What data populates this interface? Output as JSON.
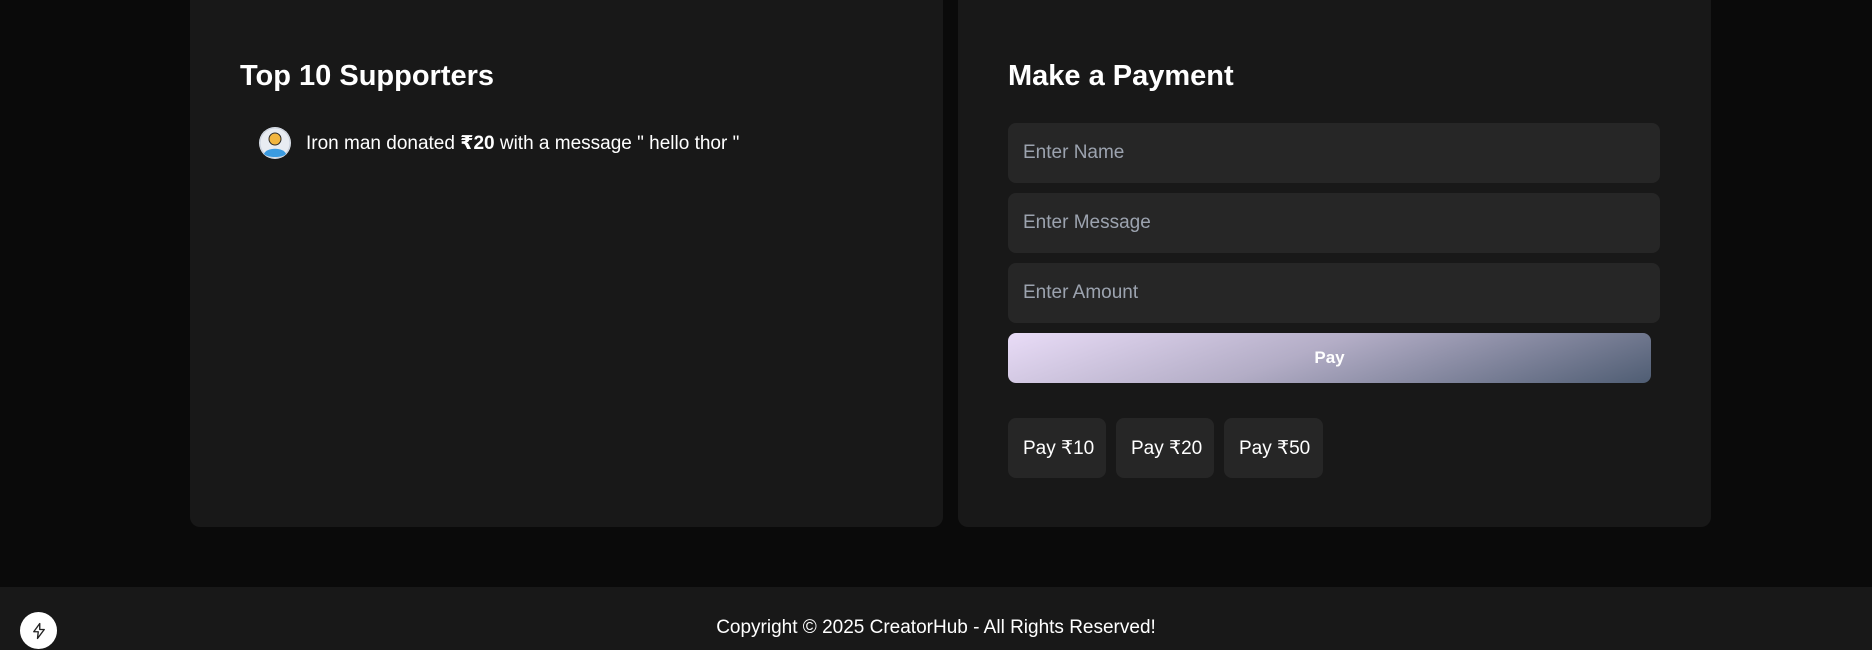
{
  "supporters": {
    "title": "Top 10 Supporters",
    "items": [
      {
        "name_prefix": "Iron man donated ",
        "amount": "₹20",
        "message_text": " with a message \" hello thor \""
      }
    ]
  },
  "payment": {
    "title": "Make a Payment",
    "name_placeholder": "Enter Name",
    "message_placeholder": "Enter Message",
    "amount_placeholder": "Enter Amount",
    "pay_label": "Pay",
    "quick_pay": [
      "Pay ₹10",
      "Pay ₹20",
      "Pay ₹50"
    ]
  },
  "footer": {
    "copyright": "Copyright © 2025 CreatorHub - All Rights Reserved!"
  },
  "icons": {
    "avatar": "user-avatar-icon",
    "bolt": "lightning-bolt-icon"
  },
  "colors": {
    "page_background": "#0a0a0a",
    "panel_background": "#181818",
    "input_background": "#262626",
    "pay_gradient_start": "#e9dcf7",
    "pay_gradient_end": "#4f5d73"
  }
}
